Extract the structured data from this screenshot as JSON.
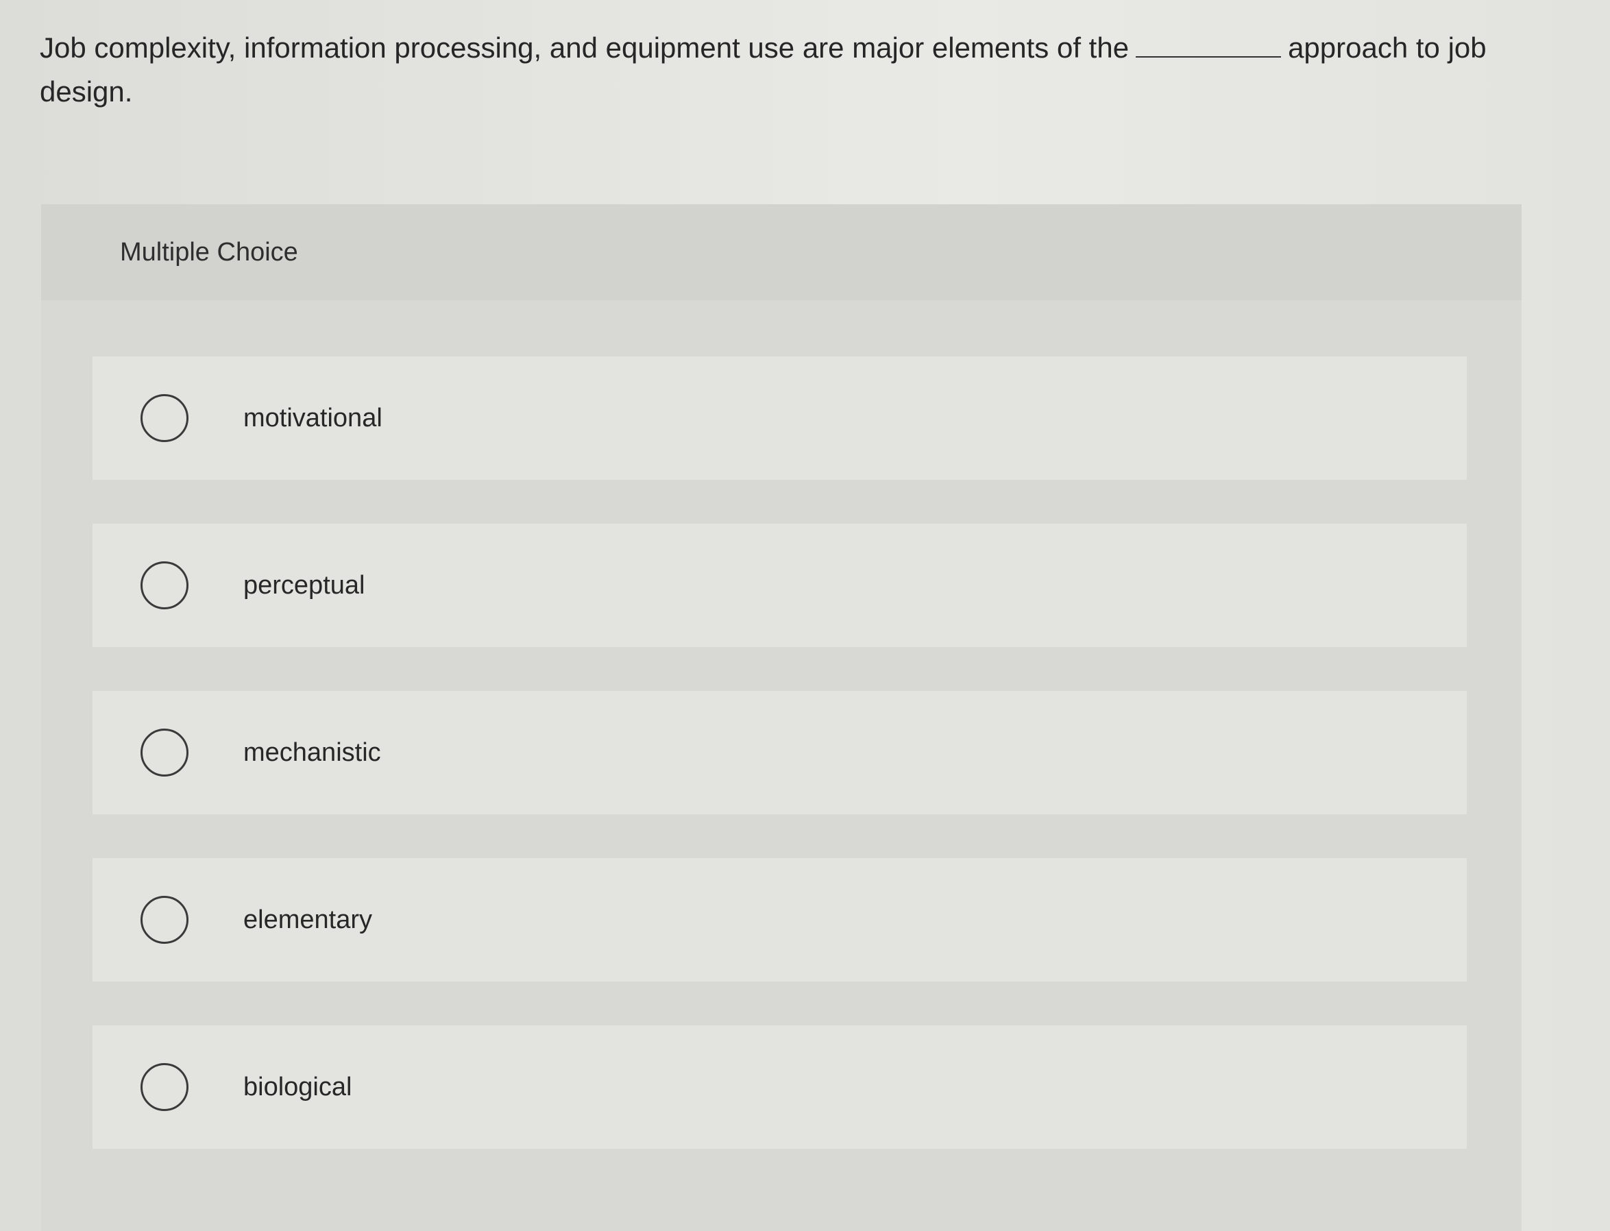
{
  "question": {
    "text_before": "Job complexity, information processing, and equipment use are major elements of the",
    "text_after": "approach to job design."
  },
  "multiple_choice": {
    "header": "Multiple Choice",
    "options": [
      {
        "label": "motivational",
        "selected": false
      },
      {
        "label": "perceptual",
        "selected": false
      },
      {
        "label": "mechanistic",
        "selected": false
      },
      {
        "label": "elementary",
        "selected": false
      },
      {
        "label": "biological",
        "selected": false
      }
    ]
  }
}
